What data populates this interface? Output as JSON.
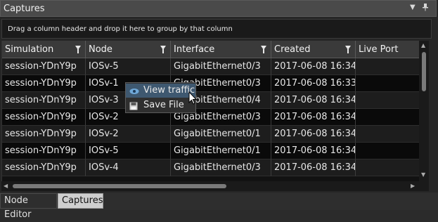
{
  "panel": {
    "title": "Captures"
  },
  "group_hint": "Drag a column header and drop it here to group by that column",
  "columns": [
    "Simulation",
    "Node",
    "Interface",
    "Created",
    "Live Port"
  ],
  "rows": [
    [
      "session-YDnY9p",
      "IOSv-5",
      "GigabitEthernet0/3",
      "2017-06-08 16:34",
      ""
    ],
    [
      "session-YDnY9p",
      "IOSv-1",
      "GigabitEthernet0/3",
      "2017-06-08 16:33",
      ""
    ],
    [
      "session-YDnY9p",
      "IOSv-3",
      "GigabitEthernet0/4",
      "2017-06-08 16:34",
      ""
    ],
    [
      "session-YDnY9p",
      "IOSv-2",
      "GigabitEthernet0/3",
      "2017-06-08 16:34",
      ""
    ],
    [
      "session-YDnY9p",
      "IOSv-2",
      "GigabitEthernet0/1",
      "2017-06-08 16:34",
      ""
    ],
    [
      "session-YDnY9p",
      "IOSv-5",
      "GigabitEthernet0/1",
      "2017-06-08 16:34",
      ""
    ],
    [
      "session-YDnY9p",
      "IOSv-4",
      "GigabitEthernet0/3",
      "2017-06-08 16:34",
      ""
    ]
  ],
  "context_menu": {
    "items": [
      "View traffic",
      "Save File"
    ]
  },
  "tabs": [
    "Node Editor",
    "Captures"
  ],
  "active_tab": "Captures",
  "colors": {
    "menu_highlight": "#3e5870",
    "active_tab": "#cfcfcf"
  },
  "icons": [
    "pin-icon",
    "dropdown-icon",
    "filter-icon",
    "eye-icon",
    "save-icon",
    "mouse-cursor-icon"
  ]
}
